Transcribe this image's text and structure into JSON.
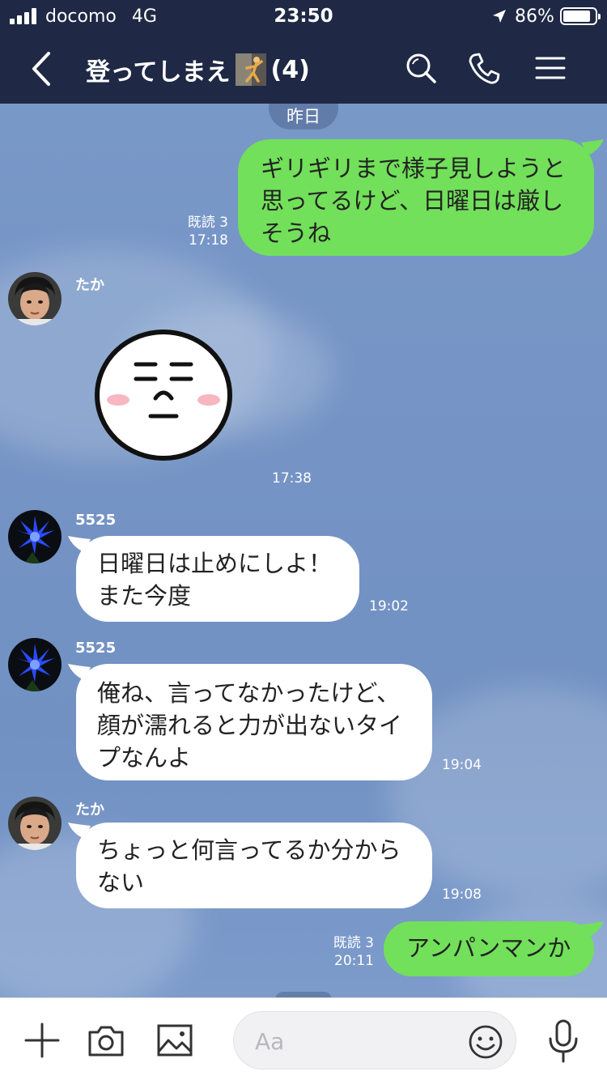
{
  "status_bar": {
    "carrier": "docomo",
    "network": "4G",
    "time": "23:50",
    "battery": "86%"
  },
  "header": {
    "title": "登ってしまえ",
    "member_count": "(4)",
    "icons": [
      "back-icon",
      "climber-icon",
      "search-icon",
      "phone-icon",
      "menu-icon"
    ]
  },
  "chat": {
    "date_label": "昨日",
    "messages": [
      {
        "direction": "out",
        "lines": [
          "ギリギリまで様子見しようと",
          "思ってるけど、日曜日は厳し",
          "そうね"
        ],
        "read": "既読 3",
        "time": "17:18"
      },
      {
        "direction": "in",
        "sender": "たか",
        "type": "sticker",
        "time": "17:38"
      },
      {
        "direction": "in",
        "sender": "5525",
        "lines": [
          "日曜日は止めにしよ！",
          "また今度"
        ],
        "time": "19:02"
      },
      {
        "direction": "in",
        "sender": "5525",
        "lines": [
          "俺ね、言ってなかったけど、",
          "顔が濡れると力が出ないタイ",
          "プなんよ"
        ],
        "time": "19:04"
      },
      {
        "direction": "in",
        "sender": "たか",
        "lines": [
          "ちょっと何言ってるか分から",
          "ない"
        ],
        "time": "19:08"
      },
      {
        "direction": "out",
        "lines": [
          "アンパンマンか"
        ],
        "read": "既読 3",
        "time": "20:11"
      }
    ]
  },
  "input_bar": {
    "placeholder": "Aa",
    "icons": [
      "plus-icon",
      "camera-icon",
      "image-icon",
      "emoji-icon",
      "microphone-icon"
    ]
  },
  "colors": {
    "header_bg": "#1f2945",
    "chat_bg": "#7594c5",
    "outgoing_bubble": "#72e05a",
    "incoming_bubble": "#ffffff"
  }
}
